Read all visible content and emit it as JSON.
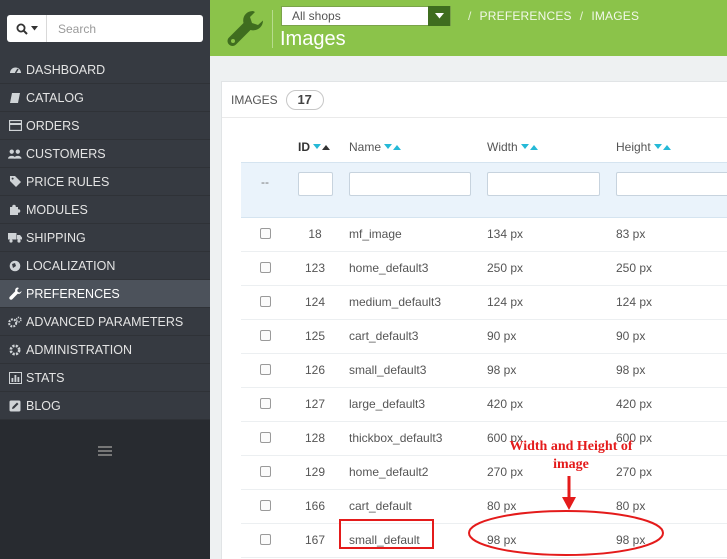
{
  "sidebar": {
    "search": {
      "placeholder": "Search",
      "icon": "search-icon"
    },
    "items": [
      {
        "label": "DASHBOARD",
        "icon": "dashboard-icon",
        "active": false
      },
      {
        "label": "CATALOG",
        "icon": "book-icon",
        "active": false
      },
      {
        "label": "ORDERS",
        "icon": "credit-card-icon",
        "active": false
      },
      {
        "label": "CUSTOMERS",
        "icon": "users-icon",
        "active": false
      },
      {
        "label": "PRICE RULES",
        "icon": "tag-icon",
        "active": false
      },
      {
        "label": "MODULES",
        "icon": "puzzle-icon",
        "active": false
      },
      {
        "label": "SHIPPING",
        "icon": "truck-icon",
        "active": false
      },
      {
        "label": "LOCALIZATION",
        "icon": "globe-icon",
        "active": false
      },
      {
        "label": "PREFERENCES",
        "icon": "wrench-icon",
        "active": true
      },
      {
        "label": "ADVANCED PARAMETERS",
        "icon": "cogs-icon",
        "active": false
      },
      {
        "label": "ADMINISTRATION",
        "icon": "cog-icon",
        "active": false
      },
      {
        "label": "STATS",
        "icon": "bar-chart-icon",
        "active": false
      },
      {
        "label": "BLOG",
        "icon": "pencil-icon",
        "active": false
      }
    ]
  },
  "header": {
    "shop_select": "All shops",
    "breadcrumb": [
      "PREFERENCES",
      "IMAGES"
    ],
    "title": "Images",
    "colors": {
      "bar": "#8bc34a",
      "caret_bg": "#3f6d1f"
    }
  },
  "panel": {
    "heading": "IMAGES",
    "count": "17"
  },
  "table": {
    "columns": {
      "id": "ID",
      "name": "Name",
      "width": "Width",
      "height": "Height"
    },
    "filter_placeholder": "--",
    "rows": [
      {
        "id": "18",
        "name": "mf_image",
        "width": "134 px",
        "height": "83 px"
      },
      {
        "id": "123",
        "name": "home_default3",
        "width": "250 px",
        "height": "250 px"
      },
      {
        "id": "124",
        "name": "medium_default3",
        "width": "124 px",
        "height": "124 px"
      },
      {
        "id": "125",
        "name": "cart_default3",
        "width": "90 px",
        "height": "90 px"
      },
      {
        "id": "126",
        "name": "small_default3",
        "width": "98 px",
        "height": "98 px"
      },
      {
        "id": "127",
        "name": "large_default3",
        "width": "420 px",
        "height": "420 px"
      },
      {
        "id": "128",
        "name": "thickbox_default3",
        "width": "600 px",
        "height": "600 px"
      },
      {
        "id": "129",
        "name": "home_default2",
        "width": "270 px",
        "height": "270 px"
      },
      {
        "id": "166",
        "name": "cart_default",
        "width": "80 px",
        "height": "80 px"
      },
      {
        "id": "167",
        "name": "small_default",
        "width": "98 px",
        "height": "98 px"
      }
    ]
  },
  "annotation": {
    "text_line1": "Width and Height of",
    "text_line2": "image",
    "color": "#e41b1b"
  }
}
